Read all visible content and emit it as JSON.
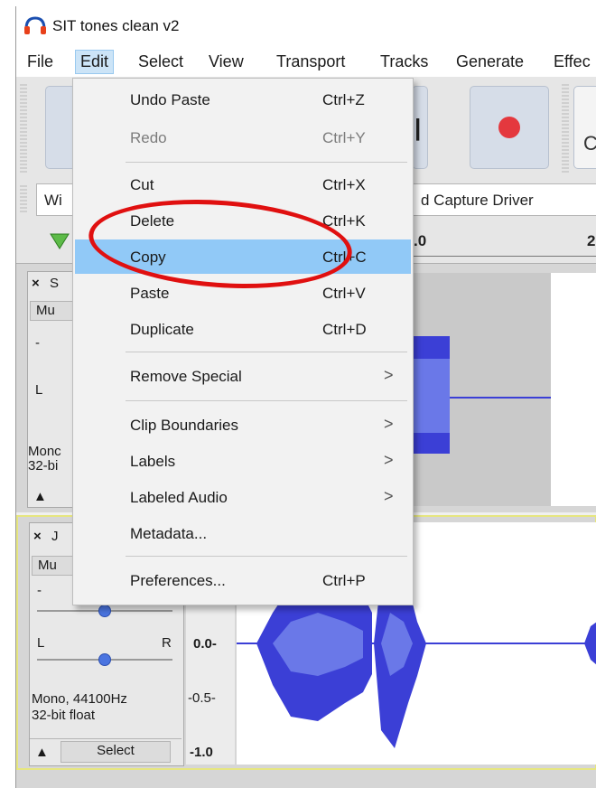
{
  "window": {
    "title": "SIT tones clean v2"
  },
  "menubar": {
    "items": [
      "File",
      "Edit",
      "Select",
      "View",
      "Transport",
      "Tracks",
      "Generate",
      "Effec"
    ],
    "active": "Edit"
  },
  "toolbar": {
    "right_glyph": "C",
    "ruler_num_1": ".0",
    "ruler_num_2": "2"
  },
  "device_toolbar": {
    "host_partial": "Wi",
    "device_partial": "d Capture Driver"
  },
  "edit_menu": {
    "items": [
      {
        "label": "Undo Paste",
        "shortcut": "Ctrl+Z",
        "enabled": true
      },
      {
        "label": "Redo",
        "shortcut": "Ctrl+Y",
        "enabled": false
      },
      {
        "label": "Cut",
        "shortcut": "Ctrl+X",
        "enabled": true
      },
      {
        "label": "Delete",
        "shortcut": "Ctrl+K",
        "enabled": true
      },
      {
        "label": "Copy",
        "shortcut": "Ctrl+C",
        "enabled": true,
        "highlighted": true
      },
      {
        "label": "Paste",
        "shortcut": "Ctrl+V",
        "enabled": true
      },
      {
        "label": "Duplicate",
        "shortcut": "Ctrl+D",
        "enabled": true
      },
      {
        "label": "Remove Special",
        "submenu": ">"
      },
      {
        "label": "Clip Boundaries",
        "submenu": ">"
      },
      {
        "label": "Labels",
        "submenu": ">"
      },
      {
        "label": "Labeled Audio",
        "submenu": ">"
      },
      {
        "label": "Metadata..."
      },
      {
        "label": "Preferences...",
        "shortcut": "Ctrl+P"
      }
    ]
  },
  "track1": {
    "close": "×",
    "name_partial": "S",
    "mute_partial": "Mu",
    "gain_minus": "-",
    "pan_left": "L",
    "format_line1": "Monc",
    "format_line2": "32-bi",
    "collapse": "▲"
  },
  "track2": {
    "close": "×",
    "name_partial": "J",
    "mute_partial": "Mu",
    "gain_minus": "-",
    "pan_left": "L",
    "pan_right": "R",
    "format_line1": "Mono, 44100Hz",
    "format_line2": "32-bit float",
    "collapse": "▲",
    "select_label": "Select",
    "scale": [
      "0.0-",
      "-0.5-",
      "-1.0"
    ]
  },
  "colors": {
    "highlight": "#91c9f7",
    "annotation": "#e01010",
    "waveform": "#3b3fd6",
    "record": "#e4383e"
  }
}
